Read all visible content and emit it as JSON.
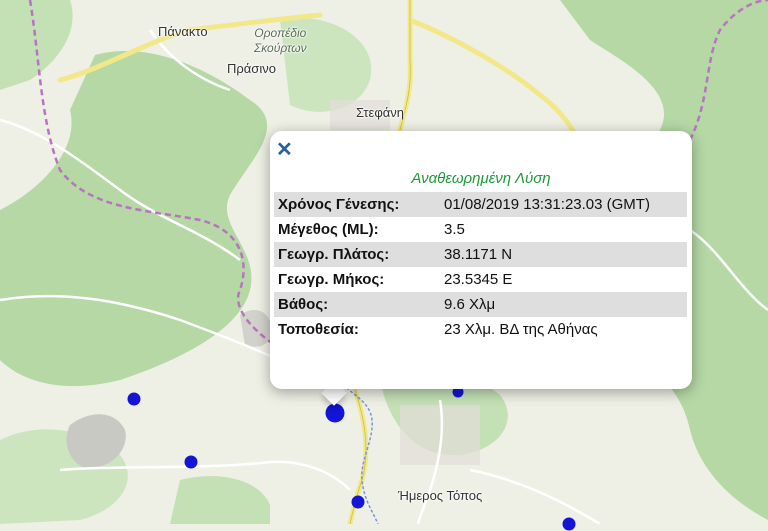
{
  "places": {
    "panakto": "Πάνακτο",
    "oropedio_line1": "Οροπέδιο",
    "oropedio_line2": "Σκούρτων",
    "prasino": "Πράσινο",
    "stefani": "Στεφάνη",
    "imeros_topos": "Ήμερος Τόπος"
  },
  "popup": {
    "close_icon": "close-icon",
    "title": "Αναθεωρημένη Λύση",
    "rows": [
      {
        "label": "Χρόνος Γένεσης:",
        "value": "01/08/2019 13:31:23.03 (GMT)"
      },
      {
        "label": "Μέγεθος (ML):",
        "value": "3.5"
      },
      {
        "label": "Γεωγρ. Πλάτος:",
        "value": "38.1171 N"
      },
      {
        "label": "Γεωγρ. Μήκος:",
        "value": "23.5345 E"
      },
      {
        "label": "Βάθος:",
        "value": "9.6 Χλμ"
      },
      {
        "label": "Τοποθεσία:",
        "value": "23 Χλμ. ΒΔ της Αθήνας"
      }
    ]
  },
  "colors": {
    "forest": "#b5d8a5",
    "background": "#eef0e6",
    "road_major": "#f2e88a",
    "boundary": "#b873c2",
    "river": "#7a95d8",
    "quake_marker": "#1414d6",
    "title_green": "#1d9a3a"
  }
}
